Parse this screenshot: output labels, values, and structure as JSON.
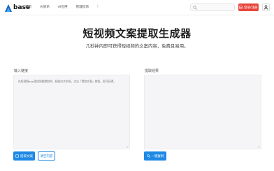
{
  "header": {
    "logo_text": "base",
    "nav": [
      "首页",
      "AI资讯",
      "AI应用",
      "管理指南"
    ],
    "more_symbol": "⋮",
    "search": {
      "placeholder": ""
    },
    "login_label": "登录/注册"
  },
  "hero": {
    "title": "短视频文案提取生成器",
    "subtitle": "几秒钟内即可获得短视频的文案内容，免费且易用。"
  },
  "input_panel": {
    "label": "输入链接",
    "placeholder": "在短视频app里找到想提取的，粘贴内文本框，点击「提取文案」按钮，即可获得。",
    "extract_label": "提取文案",
    "clear_label": "清空内容"
  },
  "result_panel": {
    "label": "提取结果",
    "value": "",
    "copy_label": "一键复制"
  },
  "colors": {
    "brand_blue": "#1e88e5",
    "login_red": "#e8453c",
    "logo_blue": "#1565c0"
  },
  "icons": [
    "logo-mark",
    "search-icon",
    "user-icon",
    "copy-icon",
    "extract-icon",
    "login-icon"
  ]
}
